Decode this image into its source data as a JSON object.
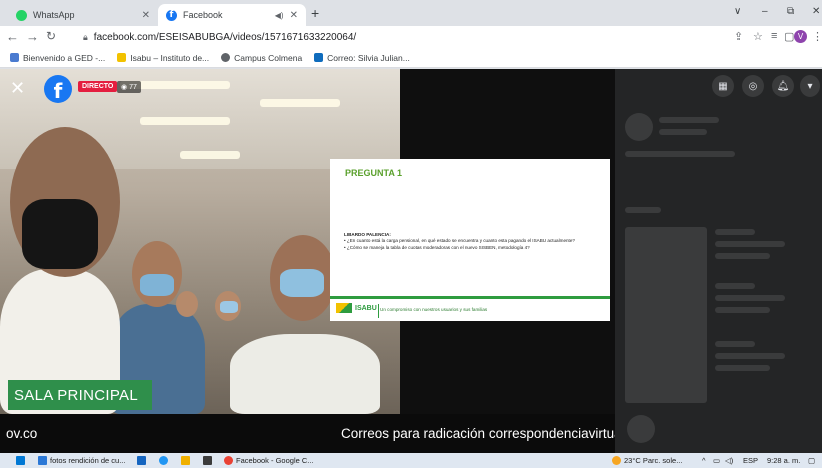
{
  "browser": {
    "tabs": [
      {
        "title": "WhatsApp",
        "icon": "whatsapp-icon",
        "active": false
      },
      {
        "title": "Facebook",
        "icon": "facebook-icon",
        "active": true
      }
    ],
    "address": "facebook.com/ESEISABUBGA/videos/1571671633220064/",
    "window_controls": [
      "∨",
      "–",
      "⧉",
      "✕"
    ],
    "profile_initial": "V"
  },
  "bookmarks": [
    {
      "label": "Bienvenido a GED -...",
      "color": "#4a7bd0"
    },
    {
      "label": "Isabu – Instituto de...",
      "color": "#f2c200"
    },
    {
      "label": "Campus Colmena",
      "color": "#5f6368"
    },
    {
      "label": "Correo: Silvia Julian...",
      "color": "#0f6cbd"
    }
  ],
  "live": {
    "badge": "DIRECTO",
    "viewers": "77",
    "viewers_icon": "eye-icon"
  },
  "slide": {
    "title": "PREGUNTA 1",
    "speaker": "LIBARDO PALENCIA:",
    "bullets": [
      "¿En cuanto está la carga pensional, en qué estado se encuentra y cuanto esta pagando el ISABU actualmente?",
      "¿Cómo se maneja la tabla de cuotas moderadoras con el nuevo SISBEN, metodología 4?"
    ],
    "logo": "ISABU",
    "tagline": "Un compromiso con nuestros usuarios y sus familias"
  },
  "overlay": {
    "room_label": "SALA PRINCIPAL",
    "ticker_left": "ov.co",
    "ticker_right": "Correos para radicación correspondenciavirtua"
  },
  "taskbar": {
    "items": [
      {
        "label": "fotos rendición de cu...",
        "color": "#2b78d6"
      },
      {
        "label": "",
        "color": "#1565c0"
      },
      {
        "label": "",
        "color": "#2196f3"
      },
      {
        "label": "",
        "color": "#f0b000"
      },
      {
        "label": "",
        "color": "#3c3c3c"
      },
      {
        "label": "Facebook - Google C...",
        "color": "#e94235"
      }
    ],
    "weather": "23°C  Parc. sole...",
    "lang": "ESP",
    "time": "9:28 a. m."
  },
  "colors": {
    "live_red": "#e41e3f",
    "facebook_blue": "#1877f2",
    "room_label_green": "#2f8f4b",
    "slide_title_green": "#5aa02c"
  }
}
